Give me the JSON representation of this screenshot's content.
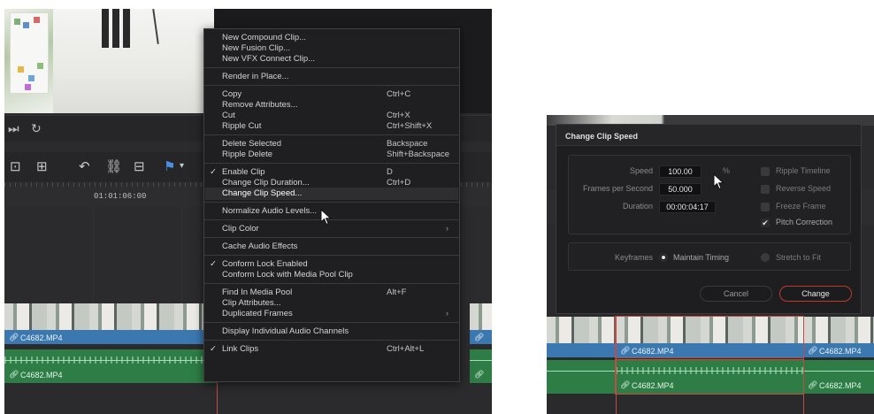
{
  "left_panel": {
    "timecode": "01:01:06:00",
    "video_clip_name": "C4682.MP4",
    "audio_clip_name": "C4682.MP4",
    "context_menu": {
      "items": [
        {
          "label": "New Compound Clip...",
          "shortcut": "",
          "checked": false,
          "submenu": false
        },
        {
          "label": "New Fusion Clip...",
          "shortcut": "",
          "checked": false,
          "submenu": false
        },
        {
          "label": "New VFX Connect Clip...",
          "shortcut": "",
          "checked": false,
          "submenu": false
        },
        {
          "label": "Render in Place...",
          "shortcut": "",
          "checked": false,
          "submenu": false
        },
        {
          "label": "Copy",
          "shortcut": "Ctrl+C",
          "checked": false,
          "submenu": false
        },
        {
          "label": "Remove Attributes...",
          "shortcut": "",
          "checked": false,
          "submenu": false
        },
        {
          "label": "Cut",
          "shortcut": "Ctrl+X",
          "checked": false,
          "submenu": false
        },
        {
          "label": "Ripple Cut",
          "shortcut": "Ctrl+Shift+X",
          "checked": false,
          "submenu": false
        },
        {
          "label": "Delete Selected",
          "shortcut": "Backspace",
          "checked": false,
          "submenu": false
        },
        {
          "label": "Ripple Delete",
          "shortcut": "Shift+Backspace",
          "checked": false,
          "submenu": false
        },
        {
          "label": "Enable Clip",
          "shortcut": "D",
          "checked": true,
          "submenu": false
        },
        {
          "label": "Change Clip Duration...",
          "shortcut": "Ctrl+D",
          "checked": false,
          "submenu": false
        },
        {
          "label": "Change Clip Speed...",
          "shortcut": "",
          "checked": false,
          "submenu": false,
          "highlighted": true
        },
        {
          "label": "Normalize Audio Levels...",
          "shortcut": "",
          "checked": false,
          "submenu": false
        },
        {
          "label": "Clip Color",
          "shortcut": "",
          "checked": false,
          "submenu": true
        },
        {
          "label": "Cache Audio Effects",
          "shortcut": "",
          "checked": false,
          "submenu": false
        },
        {
          "label": "Conform Lock Enabled",
          "shortcut": "",
          "checked": true,
          "submenu": false
        },
        {
          "label": "Conform Lock with Media Pool Clip",
          "shortcut": "",
          "checked": false,
          "submenu": false
        },
        {
          "label": "Find In Media Pool",
          "shortcut": "Alt+F",
          "checked": false,
          "submenu": false
        },
        {
          "label": "Clip Attributes...",
          "shortcut": "",
          "checked": false,
          "submenu": false
        },
        {
          "label": "Duplicated Frames",
          "shortcut": "",
          "checked": false,
          "submenu": true
        },
        {
          "label": "Display Individual Audio Channels",
          "shortcut": "",
          "checked": false,
          "submenu": false
        },
        {
          "label": "Link Clips",
          "shortcut": "Ctrl+Alt+L",
          "checked": true,
          "submenu": false
        }
      ]
    }
  },
  "dialog": {
    "title": "Change Clip Speed",
    "speed_label": "Speed",
    "speed_value": "100.00",
    "speed_unit": "%",
    "fps_label": "Frames per Second",
    "fps_value": "50.000",
    "duration_label": "Duration",
    "duration_value": "00:00:04:17",
    "options": [
      {
        "label": "Ripple Timeline",
        "checked": false
      },
      {
        "label": "Reverse Speed",
        "checked": false
      },
      {
        "label": "Freeze Frame",
        "checked": false
      },
      {
        "label": "Pitch Correction",
        "checked": true
      }
    ],
    "keyframes_label": "Keyframes",
    "keyframe_modes": [
      {
        "label": "Maintain Timing",
        "selected": true
      },
      {
        "label": "Stretch to Fit",
        "selected": false
      }
    ],
    "cancel_label": "Cancel",
    "change_label": "Change"
  },
  "right_panel": {
    "video_clip_names": [
      "C4682.MP4",
      "C4682.MP4"
    ],
    "audio_clip_names": [
      "C4682.MP4",
      "C4682.MP4"
    ]
  },
  "colors": {
    "video_track": "#3b78b0",
    "audio_track": "#2e7d47",
    "playhead": "#c44b44",
    "change_button_border": "#c0392b"
  }
}
